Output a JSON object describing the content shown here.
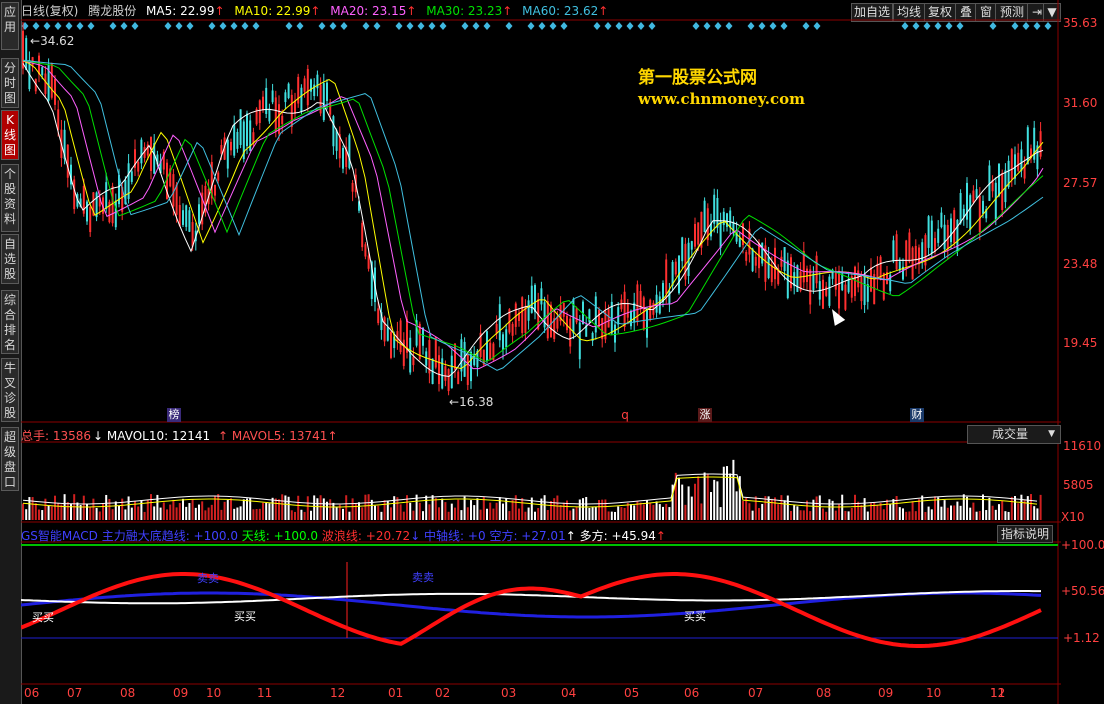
{
  "sidebar": {
    "tabs": [
      {
        "label": "应用",
        "active": false
      },
      {
        "label": "分时图",
        "active": false
      },
      {
        "label": "K线图",
        "active": true
      },
      {
        "label": "个股资料",
        "active": false
      },
      {
        "label": "自选股",
        "active": false
      },
      {
        "label": "综合排名",
        "active": false
      },
      {
        "label": "牛叉诊股",
        "active": false
      },
      {
        "label": "超级盘口",
        "active": false
      }
    ]
  },
  "header": {
    "period": "日线(复权)",
    "stock_name": "腾龙股份",
    "ma": [
      {
        "label": "MA5: 22.99",
        "arrow": "↑",
        "color": "#ffffff"
      },
      {
        "label": "MA10: 22.99",
        "arrow": "↑",
        "color": "#ffff00"
      },
      {
        "label": "MA20: 23.15",
        "arrow": "↑",
        "color": "#ff60ff"
      },
      {
        "label": "MA30: 23.23",
        "arrow": "↑",
        "color": "#00e000"
      },
      {
        "label": "MA60: 23.62",
        "arrow": "↑",
        "color": "#40c0e0"
      }
    ],
    "buttons": [
      "加自选",
      "均线",
      "复权",
      "叠",
      "窗",
      "预测"
    ]
  },
  "watermark": {
    "line1": "第一股票公式网",
    "line2": "www.chnmoney.com"
  },
  "price_axis": [
    "35.63",
    "31.60",
    "27.57",
    "23.48",
    "19.45"
  ],
  "price_annotations": {
    "high": "34.62",
    "low": "16.38"
  },
  "event_markers": [
    "榜",
    "q",
    "涨",
    "财"
  ],
  "volume": {
    "header": [
      {
        "text": "总手: 13586",
        "color": "#ff5050"
      },
      {
        "text": "↓ MAVOL10: 12141",
        "color": "#ffffff"
      },
      {
        "text": "↑ MAVOL5: 13741",
        "color": "#ff5050"
      },
      {
        "text": "↑",
        "color": "#ff5050"
      }
    ],
    "dropdown": "成交量",
    "axis": [
      "11610",
      "5805",
      "X10"
    ]
  },
  "indicator": {
    "header": [
      {
        "text": "GS智能MACD 主力融大底趋线",
        "color": "#4040ff"
      },
      {
        "text": ": +100.0",
        "color": "#4040ff"
      },
      {
        "text": "天线: +100.0",
        "color": "#00ff00"
      },
      {
        "text": "波浪线: +20.72",
        "color": "#ff3030"
      },
      {
        "text": "↓ 中轴线: +0",
        "color": "#4040ff"
      },
      {
        "text": "空方: +27.01",
        "color": "#4040ff"
      },
      {
        "text": "↑ 多方: +45.94",
        "color": "#ffffff"
      },
      {
        "text": "↑",
        "color": "#ff3030"
      }
    ],
    "explain_button": "指标说明",
    "axis": [
      "+100.0",
      "+50.56",
      "+1.12"
    ],
    "labels": [
      {
        "text": "卖卖"
      },
      {
        "text": "买买"
      },
      {
        "text": "买买"
      },
      {
        "text": "卖卖"
      },
      {
        "text": "买买"
      }
    ]
  },
  "months": [
    "06",
    "07",
    "08",
    "09",
    "10",
    "11",
    "12",
    "01",
    "02",
    "03",
    "04",
    "05",
    "06",
    "07",
    "08",
    "09",
    "10",
    "11",
    "12"
  ]
}
